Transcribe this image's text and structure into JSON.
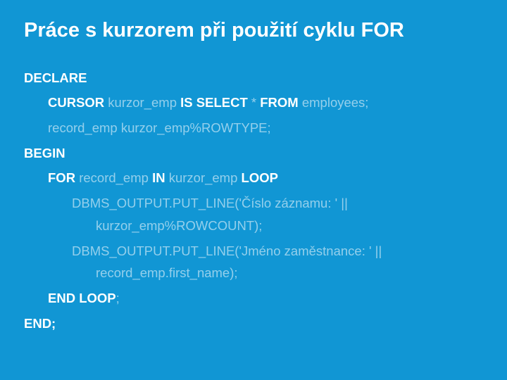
{
  "slide": {
    "title": "Práce s kurzorem při použití cyklu FOR",
    "code": {
      "declare": "DECLARE",
      "cursor_kw1": "CURSOR",
      "cursor_name": " kurzor_emp ",
      "is_kw": "IS",
      "select_kw": " SELECT ",
      "star": "* ",
      "from_kw": "FROM",
      "emp_table": " employees;",
      "record_decl": "record_emp kurzor_emp%ROWTYPE;",
      "begin": "BEGIN",
      "for_kw": "FOR",
      "for_rec": " record_emp ",
      "in_kw": "IN",
      "in_cur": " kurzor_emp ",
      "loop_kw": "LOOP",
      "put1a": "DBMS_OUTPUT.PUT_LINE('Číslo záznamu: ' ||",
      "put1b": "kurzor_emp%ROWCOUNT);",
      "put2a": "DBMS_OUTPUT.PUT_LINE('Jméno zaměstnance: ' ||",
      "put2b": "record_emp.first_name);",
      "endloop_kw": "END LOOP",
      "semicolon1": ";",
      "end_kw": "END;"
    }
  }
}
